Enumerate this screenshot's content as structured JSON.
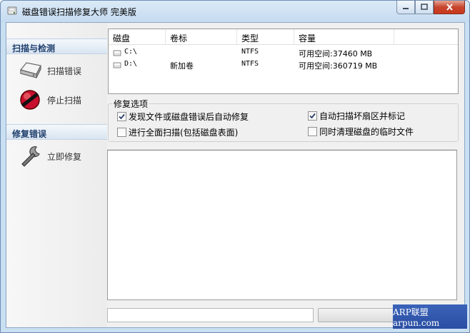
{
  "window": {
    "title": "磁盘错误扫描修复大师 完美版",
    "minimize_label": "",
    "maximize_label": "",
    "close_label": ""
  },
  "sidebar": {
    "scan_section": "扫描与检测",
    "scan_items": [
      {
        "label": "扫描错误",
        "icon": "hard-disk-icon"
      },
      {
        "label": "停止扫描",
        "icon": "stop-icon"
      }
    ],
    "repair_section": "修复错误",
    "repair_items": [
      {
        "label": "立即修复",
        "icon": "wrench-icon"
      }
    ]
  },
  "drive_list": {
    "columns": [
      "磁盘",
      "卷标",
      "类型",
      "容量"
    ],
    "rows": [
      {
        "drive": "C:\\",
        "label": "",
        "type": "NTFS",
        "capacity": "可用空间:37460 MB"
      },
      {
        "drive": "D:\\",
        "label": "新加卷",
        "type": "NTFS",
        "capacity": "可用空间:360719 MB"
      }
    ]
  },
  "options": {
    "title": "修复选项",
    "items": [
      {
        "label": "发现文件或磁盘错误后自动修复",
        "checked": true
      },
      {
        "label": "进行全面扫描(包括磁盘表面)",
        "checked": false
      },
      {
        "label": "自动扫描坏扇区并标记",
        "checked": true
      },
      {
        "label": "同时清理磁盘的临时文件",
        "checked": false
      }
    ]
  },
  "log": {
    "content": ""
  },
  "status": {
    "text": "",
    "progress": 0
  },
  "watermark": {
    "text": "ARP联盟 arpun.com"
  },
  "colors": {
    "accent": "#1f3f6e",
    "close_button": "#c5452e",
    "stop_icon": "#c8102e"
  }
}
